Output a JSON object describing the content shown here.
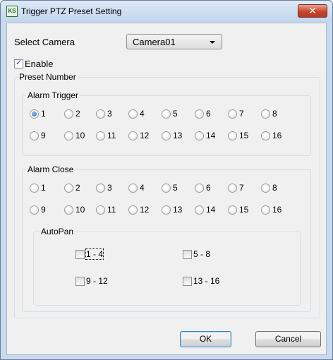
{
  "window": {
    "title": "Trigger PTZ Preset Setting",
    "close_glyph": "✕"
  },
  "camera": {
    "label": "Select Camera",
    "selected": "Camera01"
  },
  "enable": {
    "label": "Enable",
    "checked": true
  },
  "preset_number": {
    "label": "Preset Number"
  },
  "alarm_trigger": {
    "label": "Alarm Trigger",
    "options": [
      "1",
      "2",
      "3",
      "4",
      "5",
      "6",
      "7",
      "8",
      "9",
      "10",
      "11",
      "12",
      "13",
      "14",
      "15",
      "16"
    ],
    "selected": "1"
  },
  "alarm_close": {
    "label": "Alarm Close",
    "options": [
      "1",
      "2",
      "3",
      "4",
      "5",
      "6",
      "7",
      "8",
      "9",
      "10",
      "11",
      "12",
      "13",
      "14",
      "15",
      "16"
    ],
    "selected": null
  },
  "autopan": {
    "label": "AutoPan",
    "options": [
      {
        "label": "1 - 4",
        "checked": false
      },
      {
        "label": "5 - 8",
        "checked": false
      },
      {
        "label": "9 - 12",
        "checked": false
      },
      {
        "label": "13 - 16",
        "checked": false
      }
    ]
  },
  "buttons": {
    "ok": "OK",
    "cancel": "Cancel"
  }
}
